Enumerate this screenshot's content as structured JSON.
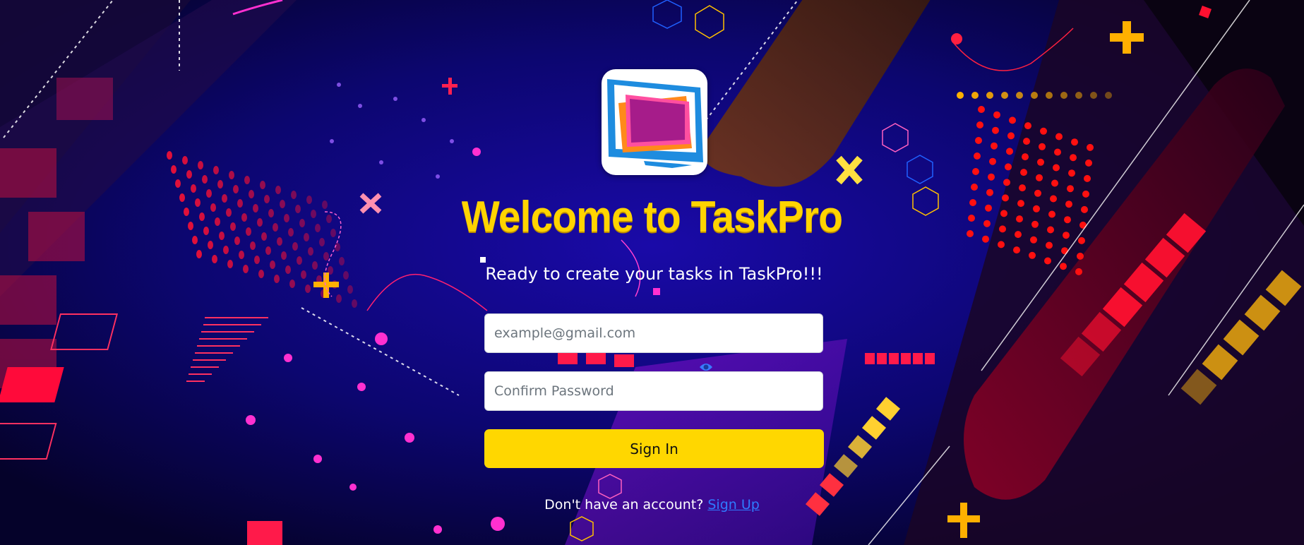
{
  "app": {
    "title": "Welcome to TaskPro",
    "subtitle": "Ready to create your tasks in TaskPro!!!"
  },
  "form": {
    "email_placeholder": "example@gmail.com",
    "email_value": "",
    "password_placeholder": "Confirm Password",
    "password_value": "",
    "submit_label": "Sign In"
  },
  "footer": {
    "prompt": "Don't have an account?",
    "link_label": "Sign Up"
  },
  "icons": {
    "logo": "monitor-logo-icon",
    "toggle": "eye-icon"
  },
  "colors": {
    "accent": "#ffd700",
    "title": "#ffd400",
    "link": "#2f7bff",
    "background": "#0a0530"
  }
}
